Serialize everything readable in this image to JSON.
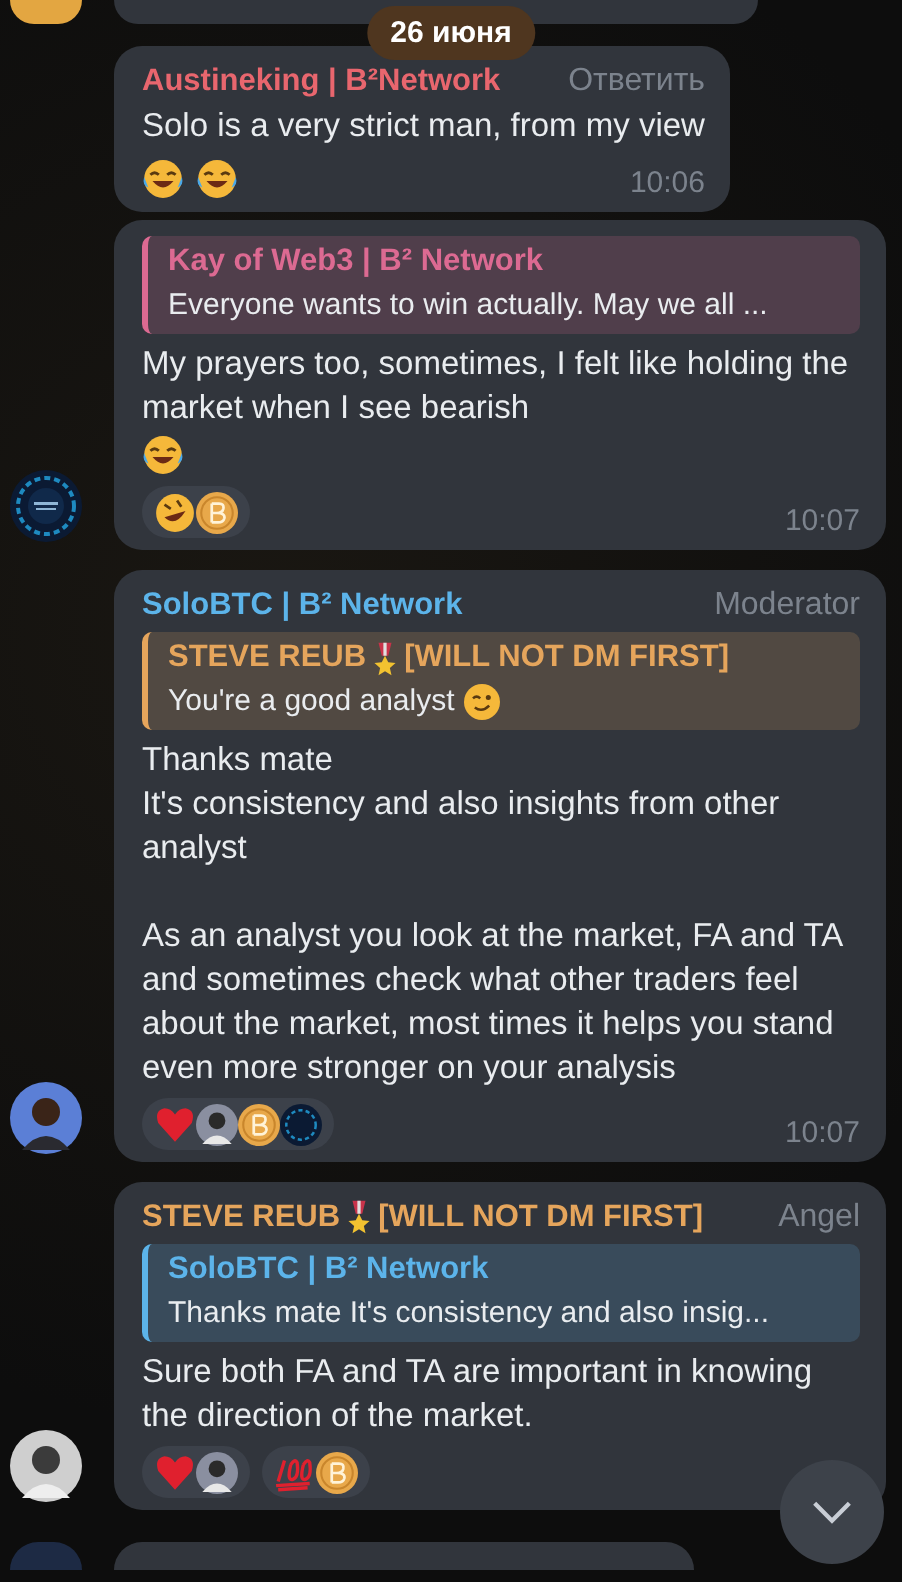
{
  "date_badge": "26 июня",
  "messages": [
    {
      "author": "Austineking | B²Network",
      "color": "#e8666e",
      "label": "Ответить",
      "text": "Solo is a very strict man, from my view",
      "emojis": [
        {
          "kind": "joy"
        },
        {
          "kind": "joy"
        }
      ],
      "time": "10:06"
    },
    {
      "reply": {
        "author": "Kay of Web3 | B² Network",
        "color": "#dc6a92",
        "text": "Everyone wants to win actually. May we all ..."
      },
      "text": "My prayers too, sometimes, I felt like holding the market when I see bearish",
      "emojis": [
        {
          "kind": "joy"
        }
      ],
      "reactions": [
        {
          "items": [
            {
              "kind": "rofl"
            },
            {
              "kind": "coin"
            }
          ]
        }
      ],
      "time": "10:07",
      "avatar": {
        "kind": "logo"
      }
    },
    {
      "author": "SoloBTC | B² Network",
      "color": "#5cb4ea",
      "label": "Moderator",
      "reply": {
        "author": "STEVE REUB",
        "medal": true,
        "author_tag": "[WILL NOT DM FIRST]",
        "color": "#e5a55c",
        "text": "You're a good analyst",
        "emoji": {
          "kind": "wink"
        }
      },
      "text": "Thanks mate\nIt's consistency and also insights from other analyst\n\nAs an analyst you look at the market, FA and TA and sometimes check what other traders feel about the market, most times it helps you stand even more stronger on your analysis",
      "reactions": [
        {
          "items": [
            {
              "kind": "heart"
            },
            {
              "kind": "person"
            },
            {
              "kind": "coin"
            },
            {
              "kind": "logo"
            }
          ]
        }
      ],
      "time": "10:07",
      "avatar": {
        "kind": "person"
      }
    },
    {
      "author": "STEVE REUB",
      "medal": true,
      "author_tag": "[WILL NOT DM FIRST]",
      "color": "#e5a55c",
      "label": "Angel",
      "reply": {
        "author": "SoloBTC | B² Network",
        "color": "#5cb4ea",
        "text": "Thanks mate It's consistency and also insig..."
      },
      "text": "Sure both FA and TA are important in knowing the direction of the market.",
      "reactions": [
        {
          "items": [
            {
              "kind": "heart"
            },
            {
              "kind": "person"
            }
          ]
        },
        {
          "items": [
            {
              "kind": "hundred"
            },
            {
              "kind": "coin"
            }
          ]
        }
      ],
      "avatar": {
        "kind": "person-grey"
      }
    }
  ]
}
